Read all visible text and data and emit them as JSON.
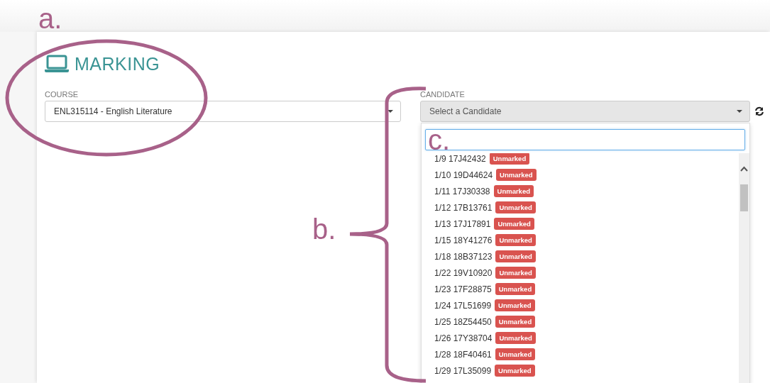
{
  "annotations": [
    {
      "label": "a."
    },
    {
      "label": "b."
    },
    {
      "label": "c."
    }
  ],
  "header": {
    "title": "MARKING"
  },
  "course": {
    "label": "COURSE",
    "value": "ENL315114 - English Literature"
  },
  "candidate": {
    "label": "CANDIDATE",
    "placeholder": "Select a Candidate"
  },
  "candidate_list": [
    {
      "name": "1/9 17J42432",
      "status": "Unmarked"
    },
    {
      "name": "1/10 19D44624",
      "status": "Unmarked"
    },
    {
      "name": "1/11 17J30338",
      "status": "Unmarked"
    },
    {
      "name": "1/12 17B13761",
      "status": "Unmarked"
    },
    {
      "name": "1/13 17J17891",
      "status": "Unmarked"
    },
    {
      "name": "1/15 18Y41276",
      "status": "Unmarked"
    },
    {
      "name": "1/18 18B37123",
      "status": "Unmarked"
    },
    {
      "name": "1/22 19V10920",
      "status": "Unmarked"
    },
    {
      "name": "1/23 17F28875",
      "status": "Unmarked"
    },
    {
      "name": "1/24 17L51699",
      "status": "Unmarked"
    },
    {
      "name": "1/25 18Z54450",
      "status": "Unmarked"
    },
    {
      "name": "1/26 17Y38704",
      "status": "Unmarked"
    },
    {
      "name": "1/28 18F40461",
      "status": "Unmarked"
    },
    {
      "name": "1/29 17L35099",
      "status": "Unmarked"
    }
  ]
}
